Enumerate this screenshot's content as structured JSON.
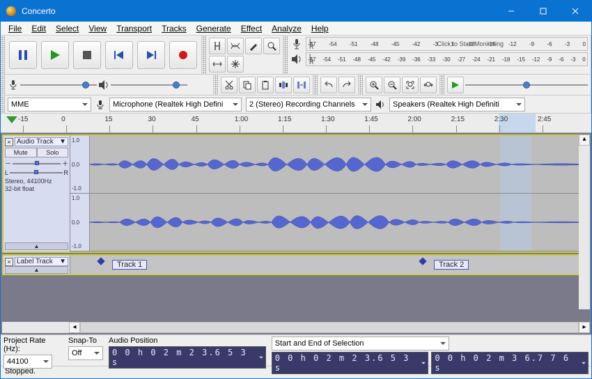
{
  "title": "Concerto",
  "menu": {
    "file": "File",
    "edit": "Edit",
    "select": "Select",
    "view": "View",
    "transport": "Transport",
    "tracks": "Tracks",
    "generate": "Generate",
    "effect": "Effect",
    "analyze": "Analyze",
    "help": "Help"
  },
  "rec_meter_label": "L\nR",
  "rec_meter_text": "Click to Start Monitoring",
  "rec_meter_ticks": [
    "-57",
    "-54",
    "-51",
    "-48",
    "-45",
    "-42",
    "-3",
    "1",
    "-18",
    "-15",
    "-12",
    "-9",
    "-6",
    "-3",
    "0"
  ],
  "play_meter_ticks": [
    "-57",
    "-54",
    "-51",
    "-48",
    "-45",
    "-42",
    "-39",
    "-36",
    "-33",
    "-30",
    "-27",
    "-24",
    "-21",
    "-18",
    "-15",
    "-12",
    "-9",
    "-6",
    "-3",
    "0"
  ],
  "host_label": "MME",
  "rec_device": "Microphone (Realtek High Defini",
  "rec_channels": "2 (Stereo) Recording Channels",
  "play_device": "Speakers (Realtek High Definiti",
  "ruler_ticks": [
    "-15",
    "0",
    "15",
    "30",
    "45",
    "1:00",
    "1:15",
    "1:30",
    "1:45",
    "2:00",
    "2:15",
    "2:30",
    "2:45"
  ],
  "sel_start_ruler": "2:23.653",
  "sel_end_ruler": "2:36.776",
  "track1": {
    "name": "Audio Track",
    "mute": "Mute",
    "solo": "Solo",
    "panL": "L",
    "panR": "R",
    "info": "Stereo, 44100Hz\n32-bit float",
    "scale": [
      "1.0",
      "0.0",
      "-1.0"
    ]
  },
  "labeltrack_name": "Label Track",
  "label1": "Track 1",
  "label2": "Track 2",
  "selbar": {
    "rate_label": "Project Rate (Hz):",
    "rate_value": "44100",
    "snap_label": "Snap-To",
    "snap_value": "Off",
    "pos_label": "Audio Position",
    "pos_value": "0 0 h 0 2 m 2 3.6 5 3 s",
    "range_label": "Start and End of Selection",
    "range_start": "0 0 h 0 2 m 2 3.6 5 3 s",
    "range_end": "0 0 h 0 2 m 3 6.7 7 6 s"
  },
  "status": "Stopped."
}
